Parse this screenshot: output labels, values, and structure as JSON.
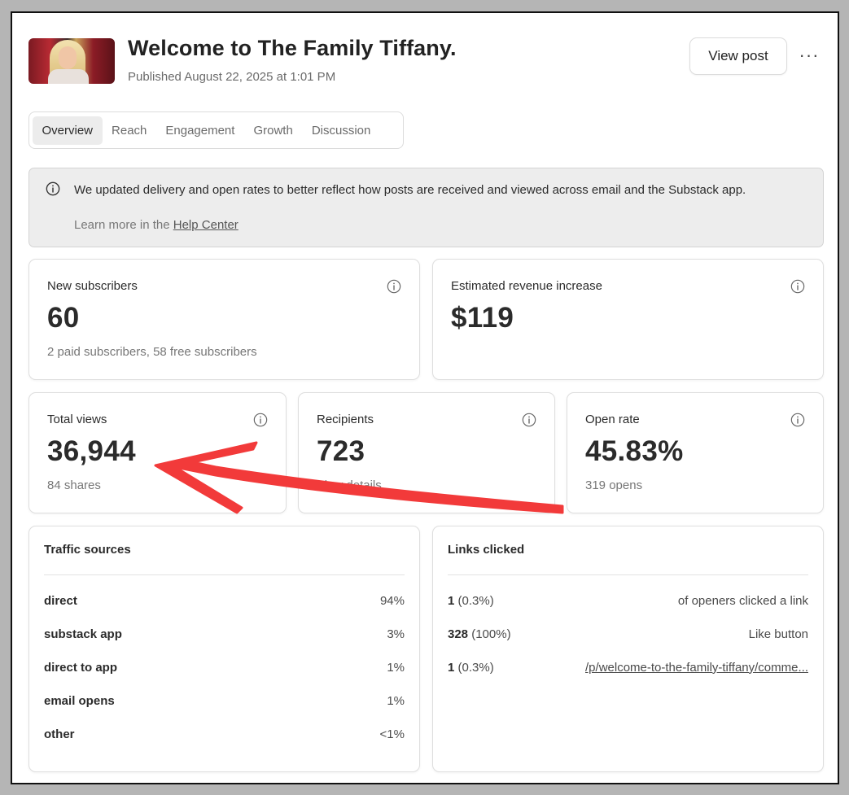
{
  "post": {
    "title": "Welcome to The Family Tiffany.",
    "published": "Published August 22, 2025 at 1:01 PM",
    "view_label": "View post",
    "more_label": "···"
  },
  "tabs": [
    {
      "label": "Overview"
    },
    {
      "label": "Reach"
    },
    {
      "label": "Engagement"
    },
    {
      "label": "Growth"
    },
    {
      "label": "Discussion"
    }
  ],
  "notice": {
    "message": "We updated delivery and open rates to better reflect how posts are received and viewed across email and the Substack app.",
    "learn_prefix": "Learn more in the",
    "learn_link": "Help Center"
  },
  "stats": {
    "new_subscribers": {
      "label": "New subscribers",
      "value": "60",
      "sub": "2 paid subscribers, 58 free subscribers"
    },
    "revenue": {
      "label": "Estimated revenue increase",
      "value": "$119"
    },
    "total_views": {
      "label": "Total views",
      "value": "36,944",
      "sub": "84 shares"
    },
    "recipients": {
      "label": "Recipients",
      "value": "723",
      "sub": "View details"
    },
    "open_rate": {
      "label": "Open rate",
      "value": "45.83%",
      "sub": "319 opens"
    }
  },
  "traffic": {
    "title": "Traffic sources",
    "rows": [
      {
        "source": "direct",
        "pct": "94%"
      },
      {
        "source": "substack app",
        "pct": "3%"
      },
      {
        "source": "direct to app",
        "pct": "1%"
      },
      {
        "source": "email opens",
        "pct": "1%"
      },
      {
        "source": "other",
        "pct": "<1%"
      }
    ]
  },
  "links": {
    "title": "Links clicked",
    "rows": [
      {
        "count": "1",
        "pct": "(0.3%)",
        "target": "of openers clicked a link"
      },
      {
        "count": "328",
        "pct": "(100%)",
        "target": "Like button"
      },
      {
        "count": "1",
        "pct": "(0.3%)",
        "target": "/p/welcome-to-the-family-tiffany/comme..."
      }
    ]
  },
  "colors": {
    "arrow": "#f23a3a",
    "accent_text": "#2b2b2b",
    "muted_text": "#777777"
  },
  "icons": {
    "info": "info-circle-icon",
    "more": "ellipsis-icon",
    "annotation": "red-arrow-annotation"
  }
}
